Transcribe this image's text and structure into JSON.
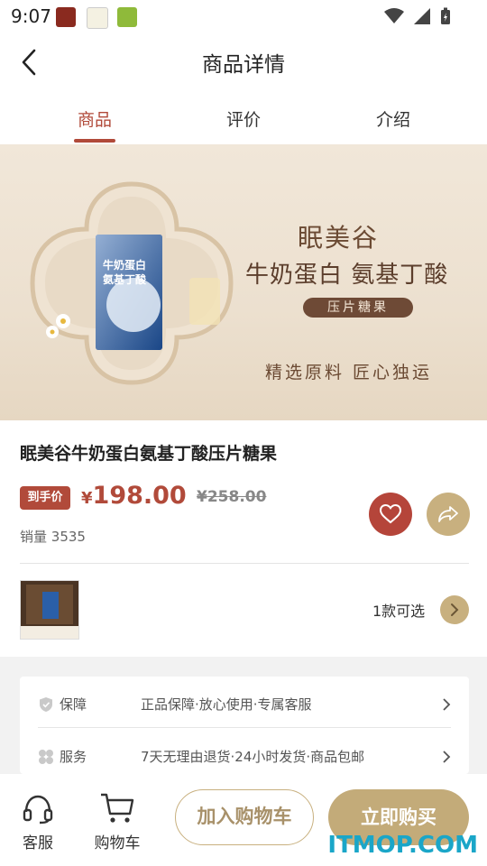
{
  "status_bar": {
    "time": "9:07"
  },
  "header": {
    "title": "商品详情"
  },
  "tabs": [
    {
      "label": "商品",
      "active": true
    },
    {
      "label": "评价",
      "active": false
    },
    {
      "label": "介绍",
      "active": false
    }
  ],
  "banner": {
    "brand": "眠美谷",
    "headline": "牛奶蛋白 氨基丁酸",
    "pill": "压片糖果",
    "slogan": "精选原料  匠心独运"
  },
  "product": {
    "name": "眠美谷牛奶蛋白氨基丁酸压片糖果",
    "price_badge": "到手价",
    "currency": "¥",
    "price": "198.00",
    "original_price": "¥258.00",
    "sales_label": "销量",
    "sales_count": "3535",
    "variant_count": "1款可选"
  },
  "services": [
    {
      "label": "保障",
      "text": "正品保障·放心使用·专属客服",
      "icon": "shield-icon"
    },
    {
      "label": "服务",
      "text": "7天无理由退货·24小时发货·商品包邮",
      "icon": "clover-icon"
    }
  ],
  "bottom_bar": {
    "customer_service": "客服",
    "cart": "购物车",
    "add_to_cart": "加入购物车",
    "buy_now": "立即购买"
  },
  "watermark": "ITMOP.COM",
  "colors": {
    "accent_red": "#b14a3a",
    "gold": "#c3ab79"
  }
}
